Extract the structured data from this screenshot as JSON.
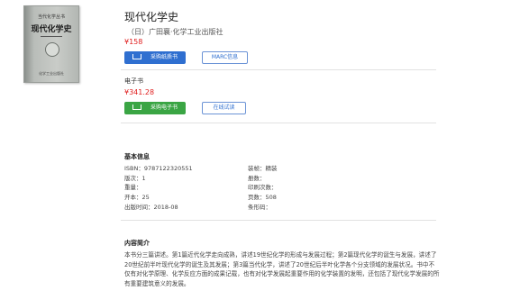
{
  "book": {
    "cover": {
      "series": "当代化学丛书",
      "title": "现代化学史",
      "publisher": "化学工业出版社"
    },
    "title": "现代化学史",
    "author": "（日）广田襄·化学工业出版社",
    "price": "¥158"
  },
  "print_actions": {
    "buy_label": "采购纸质书",
    "marc_label": "MARC信息"
  },
  "ebook": {
    "heading": "电子书",
    "price": "¥341.28",
    "buy_label": "采购电子书",
    "trial_label": "在线试读"
  },
  "basic_info": {
    "heading": "基本信息",
    "left": [
      "ISBN：9787122320551",
      "版次：1",
      "重量：",
      "开本：25",
      "出版时间：2018-08"
    ],
    "right": [
      "装帧：精装",
      "册数：",
      "印刷次数：",
      "页数：508",
      "条形码："
    ]
  },
  "intro": {
    "heading": "内容简介",
    "text": "本书分三篇讲述。第1篇近代化学走向成熟，讲述19世纪化学的形成与发展过程；第2篇现代化学的诞生与发展，讲述了20世纪前半叶现代化学的诞生及其发展；第3篇当代化学，讲述了20世纪后半叶化学各个分支领域的发展状况。书中不仅有对化学原理、化学反应方面的成果记载，也有对化学发展起重要作用的化学装置的发明，还包括了现代化学发展的所有重要建筑意义的发展。"
  },
  "colors": {
    "primary": "#2f6fd0",
    "success": "#3aa544",
    "price": "#e02020"
  }
}
